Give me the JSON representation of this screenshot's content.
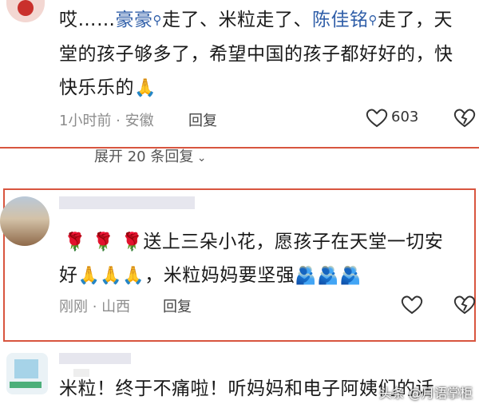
{
  "comment1": {
    "prefix": "哎……",
    "link1": "豪豪",
    "mid1": "走了、米粒走了、",
    "link2": "陈佳铭",
    "mid2": "走了，天",
    "line2": "堂的孩子够多了，希望中国的孩子都好好的，快",
    "line3": "快乐乐的",
    "emoji": "🙏",
    "time_loc": "1小时前 · 安徽",
    "reply_label": "回复",
    "like_count": "603"
  },
  "expand_replies": "展开 20 条回复",
  "comment2": {
    "line1": "送上三朵小花，愿孩子在天堂一切安",
    "flower_emoji": "🌹",
    "line2_start": "好",
    "pray_emoji": "🙏",
    "line2_mid": "，米粒妈妈要坚强",
    "hug_emoji": "🫂",
    "time_loc": "刚刚 · 山西",
    "reply_label": "回复"
  },
  "comment3": {
    "text": "米粒！终于不痛啦！听妈妈和电子阿姨们的话"
  },
  "watermark": "头条 @月语掌柜",
  "colors": {
    "highlight_border": "#d8553f",
    "link": "#2f5ea8",
    "meta": "#8c8c8c"
  }
}
